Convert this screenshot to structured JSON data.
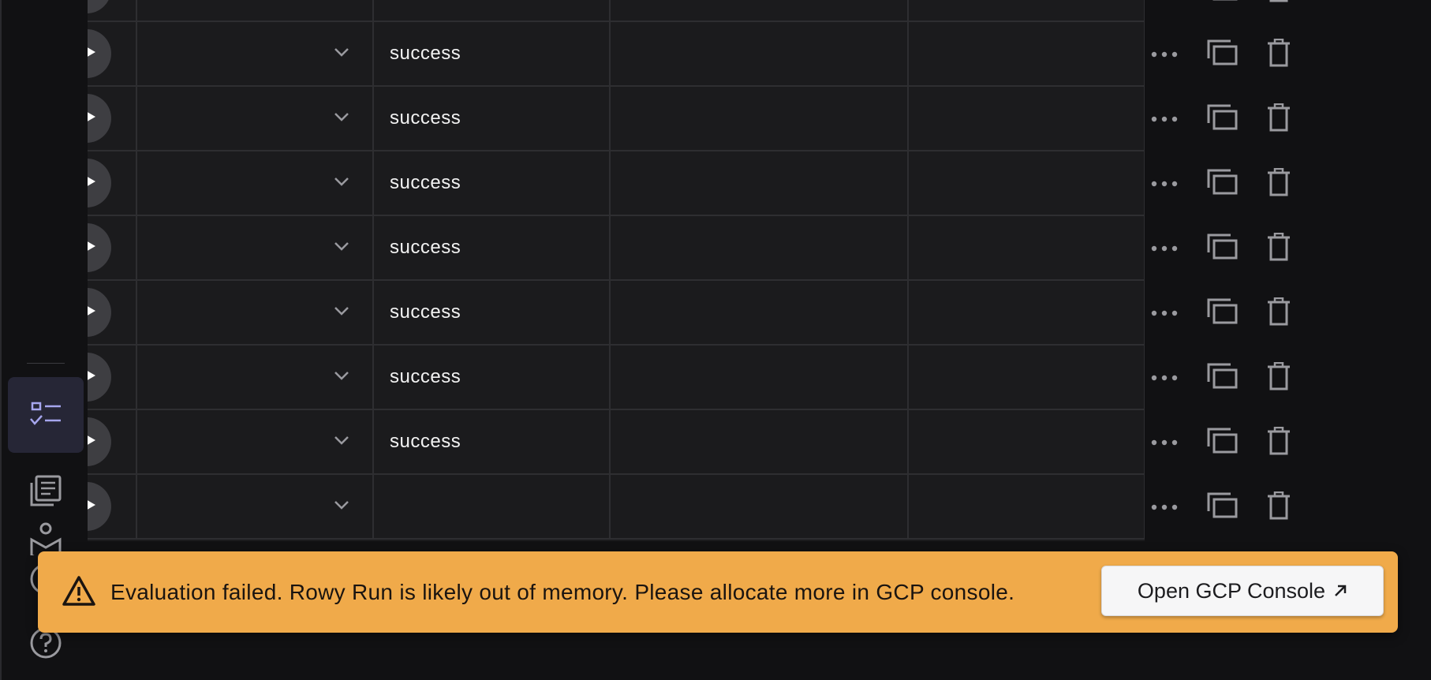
{
  "grid": {
    "rows": [
      {
        "status": ""
      },
      {
        "status": "success"
      },
      {
        "status": "success"
      },
      {
        "status": "success"
      },
      {
        "status": "success"
      },
      {
        "status": "success"
      },
      {
        "status": "success"
      },
      {
        "status": "success"
      },
      {
        "status": ""
      }
    ]
  },
  "sidebar": {
    "items": [
      {
        "icon": "checklist-icon",
        "active": true
      },
      {
        "icon": "documents-icon",
        "active": false
      },
      {
        "icon": "learning-icon",
        "active": false
      },
      {
        "icon": "info-icon",
        "active": false
      },
      {
        "icon": "help-icon",
        "active": false
      }
    ]
  },
  "snackbar": {
    "message": "Evaluation failed. Rowy Run is likely out of memory. Please allocate more in GCP console.",
    "button_label": "Open GCP Console",
    "button_icon": "external-link-icon",
    "background": "#f0aa4a"
  },
  "colors": {
    "accent": "#9b9be8",
    "grid_bg": "#1b1b1d",
    "border": "#2e2e31"
  }
}
